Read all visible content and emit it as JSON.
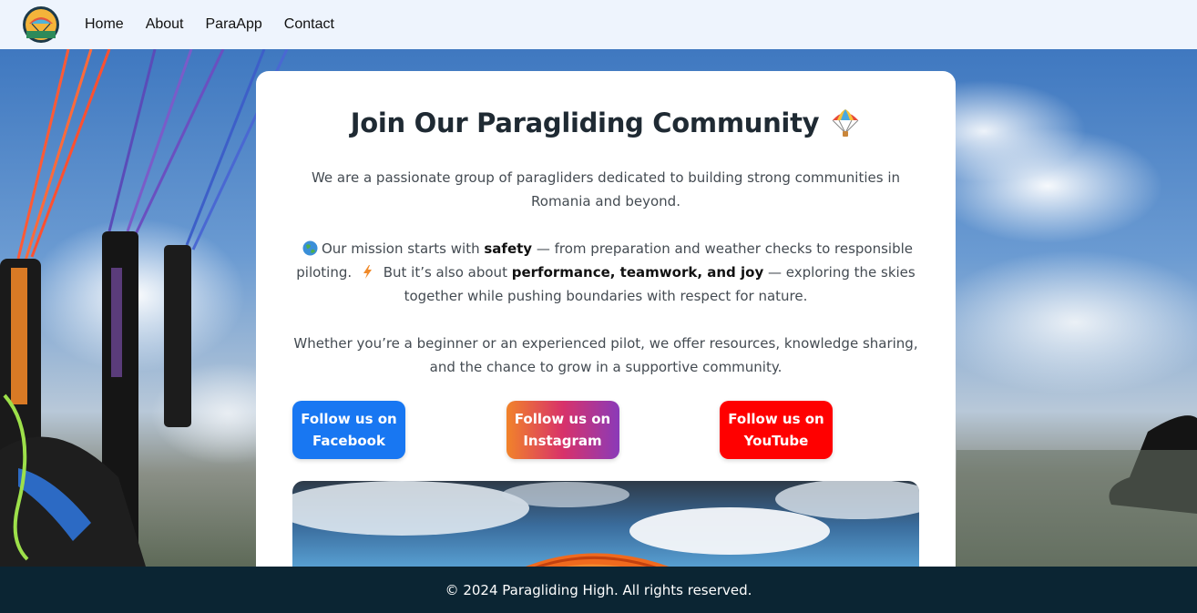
{
  "nav": {
    "logo_icon": "paraglider-logo-icon",
    "links": [
      "Home",
      "About",
      "ParaApp",
      "Contact"
    ]
  },
  "card": {
    "title": "Join Our Paragliding Community",
    "title_icon": "parachute-icon",
    "intro": "We are a passionate group of paragliders dedicated to building strong communities in Romania and beyond.",
    "mission": {
      "globe_icon": "globe-icon",
      "part1": "Our mission starts with",
      "bold1": "safety",
      "part2": "— from preparation and weather checks to responsible piloting.",
      "bolt_icon": "lightning-icon",
      "part3": "But it’s also about",
      "bold2": "performance, teamwork, and joy",
      "part4": "— exploring the skies together while pushing boundaries with respect for nature."
    },
    "closing": "Whether you’re a beginner or an experienced pilot, we offer resources, knowledge sharing, and the chance to grow in a supportive community.",
    "buttons": {
      "facebook": {
        "line1": "Follow us on",
        "line2": "Facebook"
      },
      "instagram": {
        "line1": "Follow us on",
        "line2": "Instagram"
      },
      "youtube": {
        "line1": "Follow us on",
        "line2": "YouTube"
      }
    }
  },
  "footer": {
    "text": "© 2024 Paragliding High. All rights reserved."
  },
  "colors": {
    "nav_bg": "#eef4fd",
    "footer_bg": "#0b2533",
    "facebook": "#1877f2",
    "youtube": "#ff0000"
  }
}
